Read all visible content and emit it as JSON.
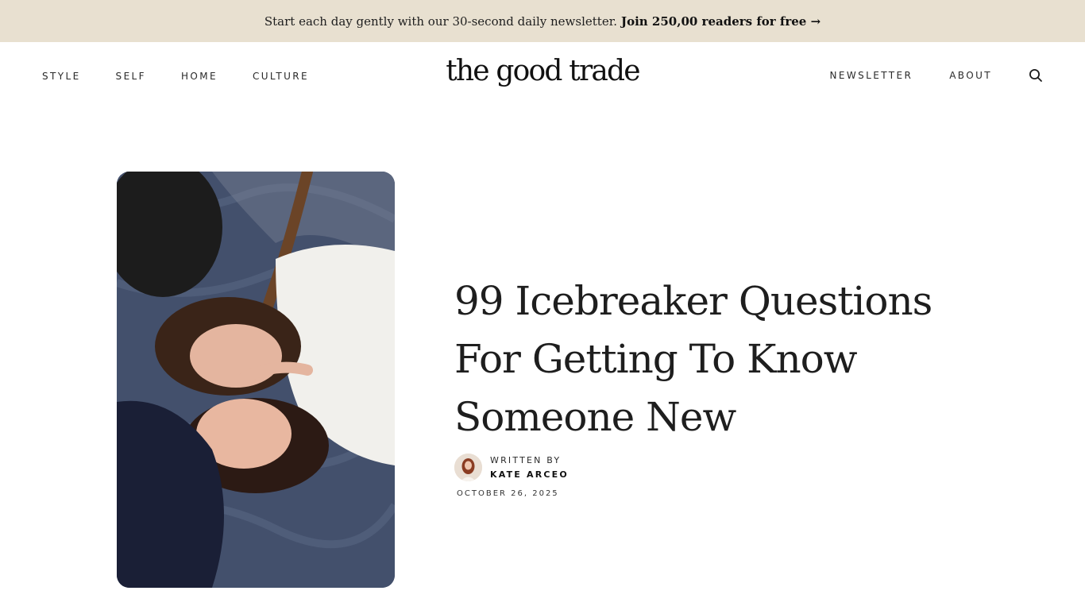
{
  "announcement": {
    "text": "Start each day gently with our 30-second daily newsletter.",
    "link": "Join 250,00 readers for free →"
  },
  "nav": {
    "left": [
      "STYLE",
      "SELF",
      "HOME",
      "CULTURE"
    ],
    "right": [
      "NEWSLETTER",
      "ABOUT"
    ],
    "search_icon": "search-icon"
  },
  "logo": "the good trade",
  "article": {
    "title": "99 Icebreaker Questions For Getting To Know Someone New",
    "written_by": "WRITTEN BY",
    "author": "KATE ARCEO",
    "date": "OCTOBER 26, 2025",
    "hero_image": "two women lying on a blanket laughing"
  },
  "colors": {
    "announcement_bg": "#e8e0d0",
    "text": "#1e1e1e"
  }
}
